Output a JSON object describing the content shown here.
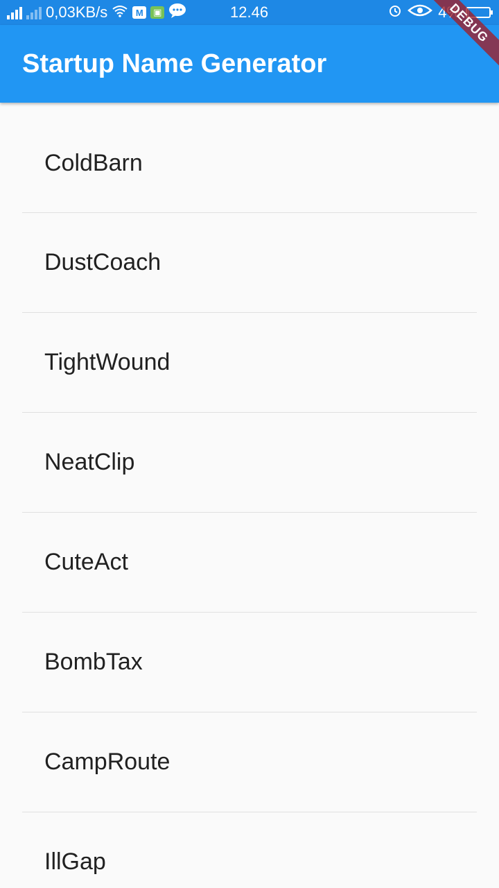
{
  "status_bar": {
    "network_speed": "0,03KB/s",
    "time": "12.46",
    "battery_percent": "4%",
    "battery_level": 0.04
  },
  "app_bar": {
    "title": "Startup Name Generator"
  },
  "debug_banner": "DEBUG",
  "list": {
    "items": [
      "ColdBarn",
      "DustCoach",
      "TightWound",
      "NeatClip",
      "CuteAct",
      "BombTax",
      "CampRoute",
      "IllGap"
    ]
  },
  "colors": {
    "primary": "#2196f3",
    "status_bar": "#1e88e5",
    "background": "#fafafa",
    "divider": "#e0e0e0",
    "text": "#212121"
  }
}
